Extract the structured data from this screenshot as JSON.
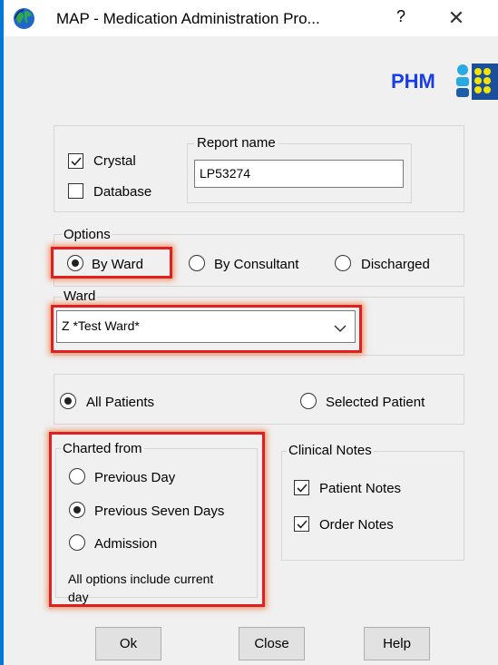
{
  "window": {
    "title": "MAP - Medication Administration Pro...",
    "help_glyph": "?",
    "close_glyph": "✕",
    "app_icon": "globe-icon"
  },
  "brand": {
    "text": "PHM",
    "color": "#1a3ee6",
    "logo_icon": "phm-logo-icon"
  },
  "report": {
    "crystal_label": "Crystal",
    "crystal_checked": true,
    "database_label": "Database",
    "database_checked": false,
    "report_name_label": "Report name",
    "report_name_value": "LP53274"
  },
  "options": {
    "label": "Options",
    "by_ward": "By Ward",
    "by_consultant": "By Consultant",
    "discharged": "Discharged",
    "selected": "By Ward"
  },
  "ward": {
    "label": "Ward",
    "value": "Z *Test Ward*"
  },
  "patients": {
    "all": "All Patients",
    "selected": "Selected Patient",
    "current": "All Patients"
  },
  "charted_from": {
    "label": "Charted from",
    "previous_day": "Previous Day",
    "previous_seven_days": "Previous Seven Days",
    "admission": "Admission",
    "selected": "Previous Seven Days",
    "note_line1": "All options include current",
    "note_line2": "day"
  },
  "clinical_notes": {
    "label": "Clinical Notes",
    "patient_notes": "Patient Notes",
    "patient_notes_checked": true,
    "order_notes": "Order Notes",
    "order_notes_checked": true
  },
  "buttons": {
    "ok": "Ok",
    "close": "Close",
    "help": "Help"
  },
  "colors": {
    "highlight": "#e02020",
    "accent_border": "#0078d7"
  }
}
